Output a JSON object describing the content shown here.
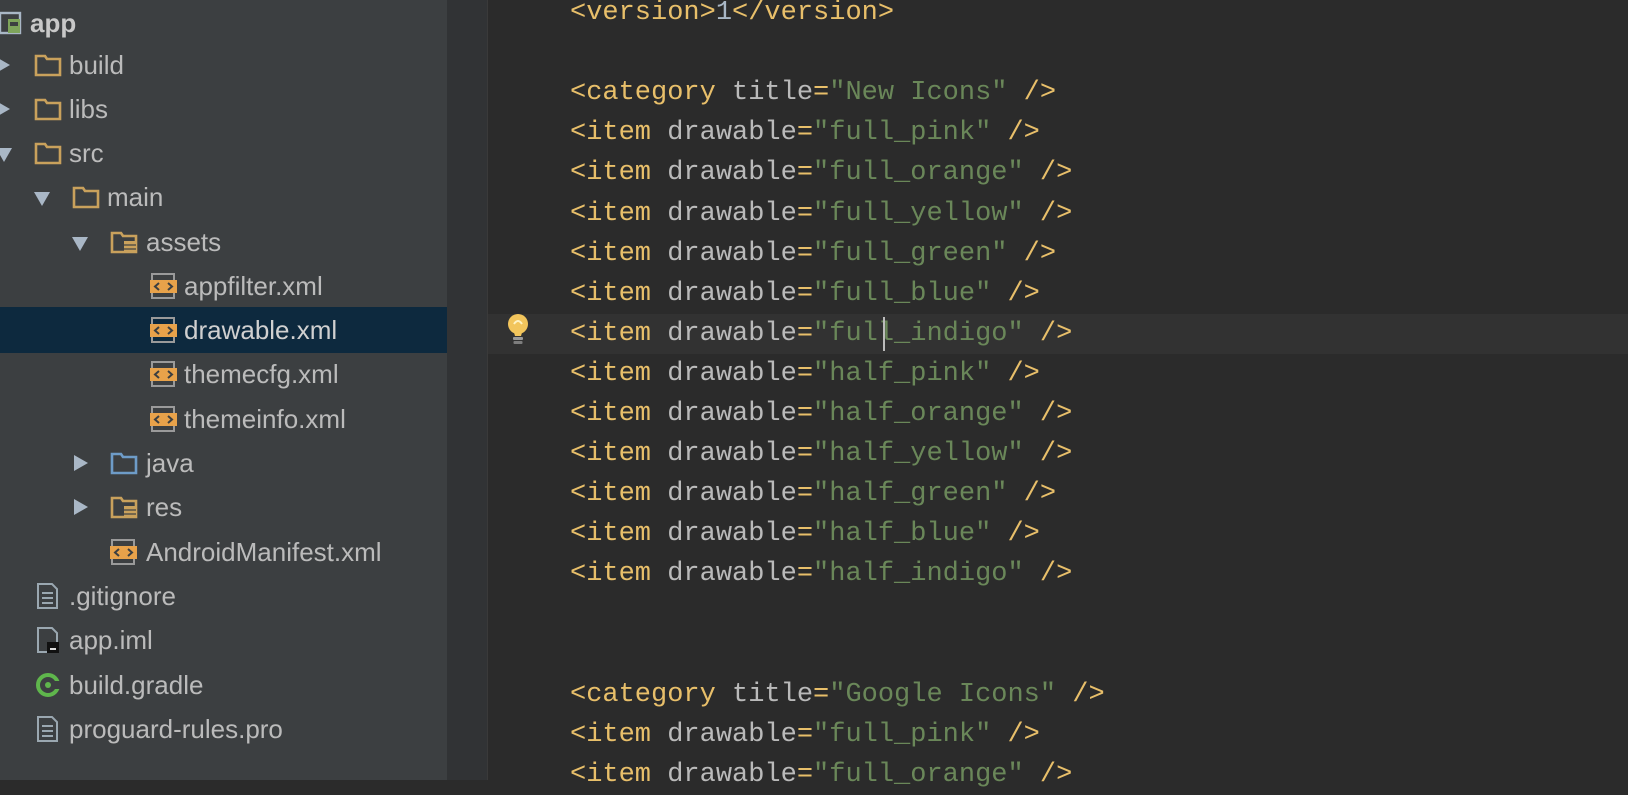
{
  "project_tree": {
    "items": [
      {
        "label": "app",
        "icon": "android-module-icon",
        "arrow": "none",
        "bold": true
      },
      {
        "label": "build",
        "icon": "folder-icon",
        "arrow": "right"
      },
      {
        "label": "libs",
        "icon": "folder-icon",
        "arrow": "right"
      },
      {
        "label": "src",
        "icon": "folder-icon",
        "arrow": "down"
      },
      {
        "label": "main",
        "icon": "folder-icon",
        "arrow": "down"
      },
      {
        "label": "assets",
        "icon": "assets-folder-icon",
        "arrow": "down"
      },
      {
        "label": "appfilter.xml",
        "icon": "xml-file-icon",
        "arrow": "none"
      },
      {
        "label": "drawable.xml",
        "icon": "xml-file-icon",
        "arrow": "none",
        "selected": true
      },
      {
        "label": "themecfg.xml",
        "icon": "xml-file-icon",
        "arrow": "none"
      },
      {
        "label": "themeinfo.xml",
        "icon": "xml-file-icon",
        "arrow": "none"
      },
      {
        "label": "java",
        "icon": "source-folder-icon",
        "arrow": "right"
      },
      {
        "label": "res",
        "icon": "resource-folder-icon",
        "arrow": "right"
      },
      {
        "label": "AndroidManifest.xml",
        "icon": "xml-file-icon",
        "arrow": "none"
      },
      {
        "label": ".gitignore",
        "icon": "text-file-icon",
        "arrow": "none"
      },
      {
        "label": "app.iml",
        "icon": "iml-file-icon",
        "arrow": "none"
      },
      {
        "label": "build.gradle",
        "icon": "gradle-icon",
        "arrow": "none"
      },
      {
        "label": "proguard-rules.pro",
        "icon": "text-file-icon",
        "arrow": "none"
      }
    ]
  },
  "editor": {
    "intention_icon": "lightbulb-icon",
    "lines": [
      {
        "tokens": [
          {
            "t": "tag",
            "v": "<version>"
          },
          {
            "t": "txt",
            "v": "1"
          },
          {
            "t": "tag",
            "v": "</version>"
          }
        ]
      },
      {
        "tokens": []
      },
      {
        "tokens": [
          {
            "t": "tag",
            "v": "<category "
          },
          {
            "t": "attr",
            "v": "title"
          },
          {
            "t": "tag",
            "v": "="
          },
          {
            "t": "val",
            "v": "\"New Icons\""
          },
          {
            "t": "tag",
            "v": " />"
          }
        ]
      },
      {
        "tokens": [
          {
            "t": "tag",
            "v": "<item "
          },
          {
            "t": "attr",
            "v": "drawable"
          },
          {
            "t": "tag",
            "v": "="
          },
          {
            "t": "val",
            "v": "\"full_pink\""
          },
          {
            "t": "tag",
            "v": " />"
          }
        ]
      },
      {
        "tokens": [
          {
            "t": "tag",
            "v": "<item "
          },
          {
            "t": "attr",
            "v": "drawable"
          },
          {
            "t": "tag",
            "v": "="
          },
          {
            "t": "val",
            "v": "\"full_orange\""
          },
          {
            "t": "tag",
            "v": " />"
          }
        ]
      },
      {
        "tokens": [
          {
            "t": "tag",
            "v": "<item "
          },
          {
            "t": "attr",
            "v": "drawable"
          },
          {
            "t": "tag",
            "v": "="
          },
          {
            "t": "val",
            "v": "\"full_yellow\""
          },
          {
            "t": "tag",
            "v": " />"
          }
        ]
      },
      {
        "tokens": [
          {
            "t": "tag",
            "v": "<item "
          },
          {
            "t": "attr",
            "v": "drawable"
          },
          {
            "t": "tag",
            "v": "="
          },
          {
            "t": "val",
            "v": "\"full_green\""
          },
          {
            "t": "tag",
            "v": " />"
          }
        ]
      },
      {
        "tokens": [
          {
            "t": "tag",
            "v": "<item "
          },
          {
            "t": "attr",
            "v": "drawable"
          },
          {
            "t": "tag",
            "v": "="
          },
          {
            "t": "val",
            "v": "\"full_blue\""
          },
          {
            "t": "tag",
            "v": " />"
          }
        ]
      },
      {
        "current": true,
        "caret_column": 18,
        "tokens": [
          {
            "t": "tag",
            "v": "<item "
          },
          {
            "t": "attr",
            "v": "drawable"
          },
          {
            "t": "tag",
            "v": "="
          },
          {
            "t": "val",
            "v": "\"full_indigo\""
          },
          {
            "t": "tag",
            "v": " />"
          }
        ]
      },
      {
        "tokens": [
          {
            "t": "tag",
            "v": "<item "
          },
          {
            "t": "attr",
            "v": "drawable"
          },
          {
            "t": "tag",
            "v": "="
          },
          {
            "t": "val",
            "v": "\"half_pink\""
          },
          {
            "t": "tag",
            "v": " />"
          }
        ]
      },
      {
        "tokens": [
          {
            "t": "tag",
            "v": "<item "
          },
          {
            "t": "attr",
            "v": "drawable"
          },
          {
            "t": "tag",
            "v": "="
          },
          {
            "t": "val",
            "v": "\"half_orange\""
          },
          {
            "t": "tag",
            "v": " />"
          }
        ]
      },
      {
        "tokens": [
          {
            "t": "tag",
            "v": "<item "
          },
          {
            "t": "attr",
            "v": "drawable"
          },
          {
            "t": "tag",
            "v": "="
          },
          {
            "t": "val",
            "v": "\"half_yellow\""
          },
          {
            "t": "tag",
            "v": " />"
          }
        ]
      },
      {
        "tokens": [
          {
            "t": "tag",
            "v": "<item "
          },
          {
            "t": "attr",
            "v": "drawable"
          },
          {
            "t": "tag",
            "v": "="
          },
          {
            "t": "val",
            "v": "\"half_green\""
          },
          {
            "t": "tag",
            "v": " />"
          }
        ]
      },
      {
        "tokens": [
          {
            "t": "tag",
            "v": "<item "
          },
          {
            "t": "attr",
            "v": "drawable"
          },
          {
            "t": "tag",
            "v": "="
          },
          {
            "t": "val",
            "v": "\"half_blue\""
          },
          {
            "t": "tag",
            "v": " />"
          }
        ]
      },
      {
        "tokens": [
          {
            "t": "tag",
            "v": "<item "
          },
          {
            "t": "attr",
            "v": "drawable"
          },
          {
            "t": "tag",
            "v": "="
          },
          {
            "t": "val",
            "v": "\"half_indigo\""
          },
          {
            "t": "tag",
            "v": " />"
          }
        ]
      },
      {
        "tokens": []
      },
      {
        "tokens": []
      },
      {
        "tokens": [
          {
            "t": "tag",
            "v": "<category "
          },
          {
            "t": "attr",
            "v": "title"
          },
          {
            "t": "tag",
            "v": "="
          },
          {
            "t": "val",
            "v": "\"Google Icons\""
          },
          {
            "t": "tag",
            "v": " />"
          }
        ]
      },
      {
        "tokens": [
          {
            "t": "tag",
            "v": "<item "
          },
          {
            "t": "attr",
            "v": "drawable"
          },
          {
            "t": "tag",
            "v": "="
          },
          {
            "t": "val",
            "v": "\"full_pink\""
          },
          {
            "t": "tag",
            "v": " />"
          }
        ]
      },
      {
        "tokens": [
          {
            "t": "tag",
            "v": "<item "
          },
          {
            "t": "attr",
            "v": "drawable"
          },
          {
            "t": "tag",
            "v": "="
          },
          {
            "t": "val",
            "v": "\"full_orange\""
          },
          {
            "t": "tag",
            "v": " />"
          }
        ]
      }
    ]
  },
  "colors": {
    "sidebar_bg": "#3c3f41",
    "selection_bg": "#0d293e",
    "editor_bg": "#2b2b2b",
    "tag": "#e8bf6a",
    "attribute": "#bababa",
    "string_value": "#6a8759",
    "text": "#a9b7c6",
    "folder": "#c9a15c",
    "source_folder": "#6e9cc8",
    "gradle": "#5fb64c"
  }
}
